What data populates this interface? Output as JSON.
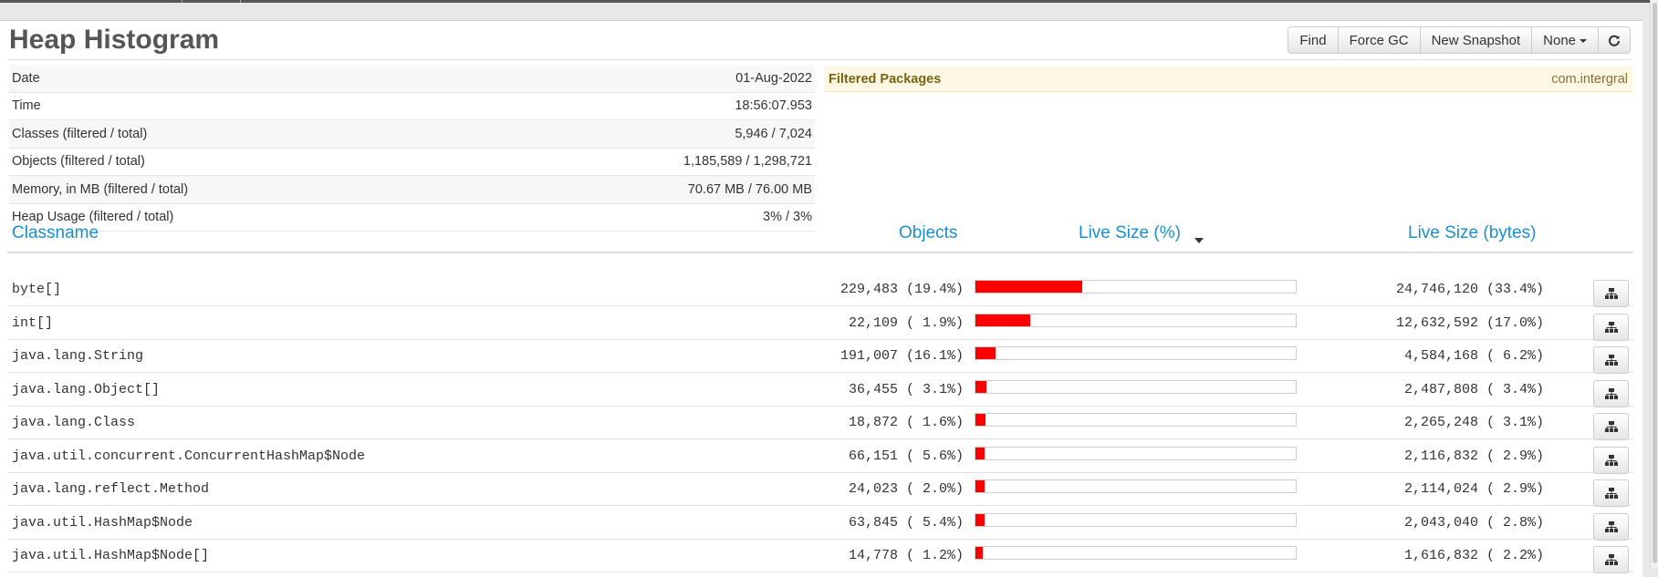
{
  "page": {
    "title": "Heap Histogram"
  },
  "toolbar": {
    "find": "Find",
    "force_gc": "Force GC",
    "new_snapshot": "New Snapshot",
    "none": "None",
    "refresh_icon": "refresh-icon"
  },
  "info": [
    {
      "label": "Date",
      "value": "01-Aug-2022"
    },
    {
      "label": "Time",
      "value": "18:56:07.953"
    },
    {
      "label": "Classes (filtered / total)",
      "value": "5,946 / 7,024"
    },
    {
      "label": "Objects (filtered / total)",
      "value": "1,185,589 / 1,298,721"
    },
    {
      "label": "Memory, in MB (filtered / total)",
      "value": "70.67 MB / 76.00 MB"
    },
    {
      "label": "Heap Usage (filtered / total)",
      "value": "3% / 3%"
    }
  ],
  "filtered": {
    "label": "Filtered Packages",
    "value": "com.intergral"
  },
  "columns": {
    "classname": "Classname",
    "objects": "Objects",
    "live_size_pct": "Live Size (%)",
    "live_size_bytes": "Live Size (bytes)"
  },
  "rows": [
    {
      "classname": "byte[]",
      "objects": "229,483 (19.4%)",
      "live_size": "24,746,120 (33.4%)",
      "live_size_fraction": 0.334
    },
    {
      "classname": "int[]",
      "objects": "22,109 ( 1.9%)",
      "live_size": "12,632,592 (17.0%)",
      "live_size_fraction": 0.17
    },
    {
      "classname": "java.lang.String",
      "objects": "191,007 (16.1%)",
      "live_size": "4,584,168 ( 6.2%)",
      "live_size_fraction": 0.062
    },
    {
      "classname": "java.lang.Object[]",
      "objects": "36,455 ( 3.1%)",
      "live_size": "2,487,808 ( 3.4%)",
      "live_size_fraction": 0.034
    },
    {
      "classname": "java.lang.Class",
      "objects": "18,872 ( 1.6%)",
      "live_size": "2,265,248 ( 3.1%)",
      "live_size_fraction": 0.031
    },
    {
      "classname": "java.util.concurrent.ConcurrentHashMap$Node",
      "objects": "66,151 ( 5.6%)",
      "live_size": "2,116,832 ( 2.9%)",
      "live_size_fraction": 0.029
    },
    {
      "classname": "java.lang.reflect.Method",
      "objects": "24,023 ( 2.0%)",
      "live_size": "2,114,024 ( 2.9%)",
      "live_size_fraction": 0.029
    },
    {
      "classname": "java.util.HashMap$Node",
      "objects": "63,845 ( 5.4%)",
      "live_size": "2,043,040 ( 2.8%)",
      "live_size_fraction": 0.028
    },
    {
      "classname": "java.util.HashMap$Node[]",
      "objects": "14,778 ( 1.2%)",
      "live_size": "1,616,832 ( 2.2%)",
      "live_size_fraction": 0.022
    }
  ]
}
